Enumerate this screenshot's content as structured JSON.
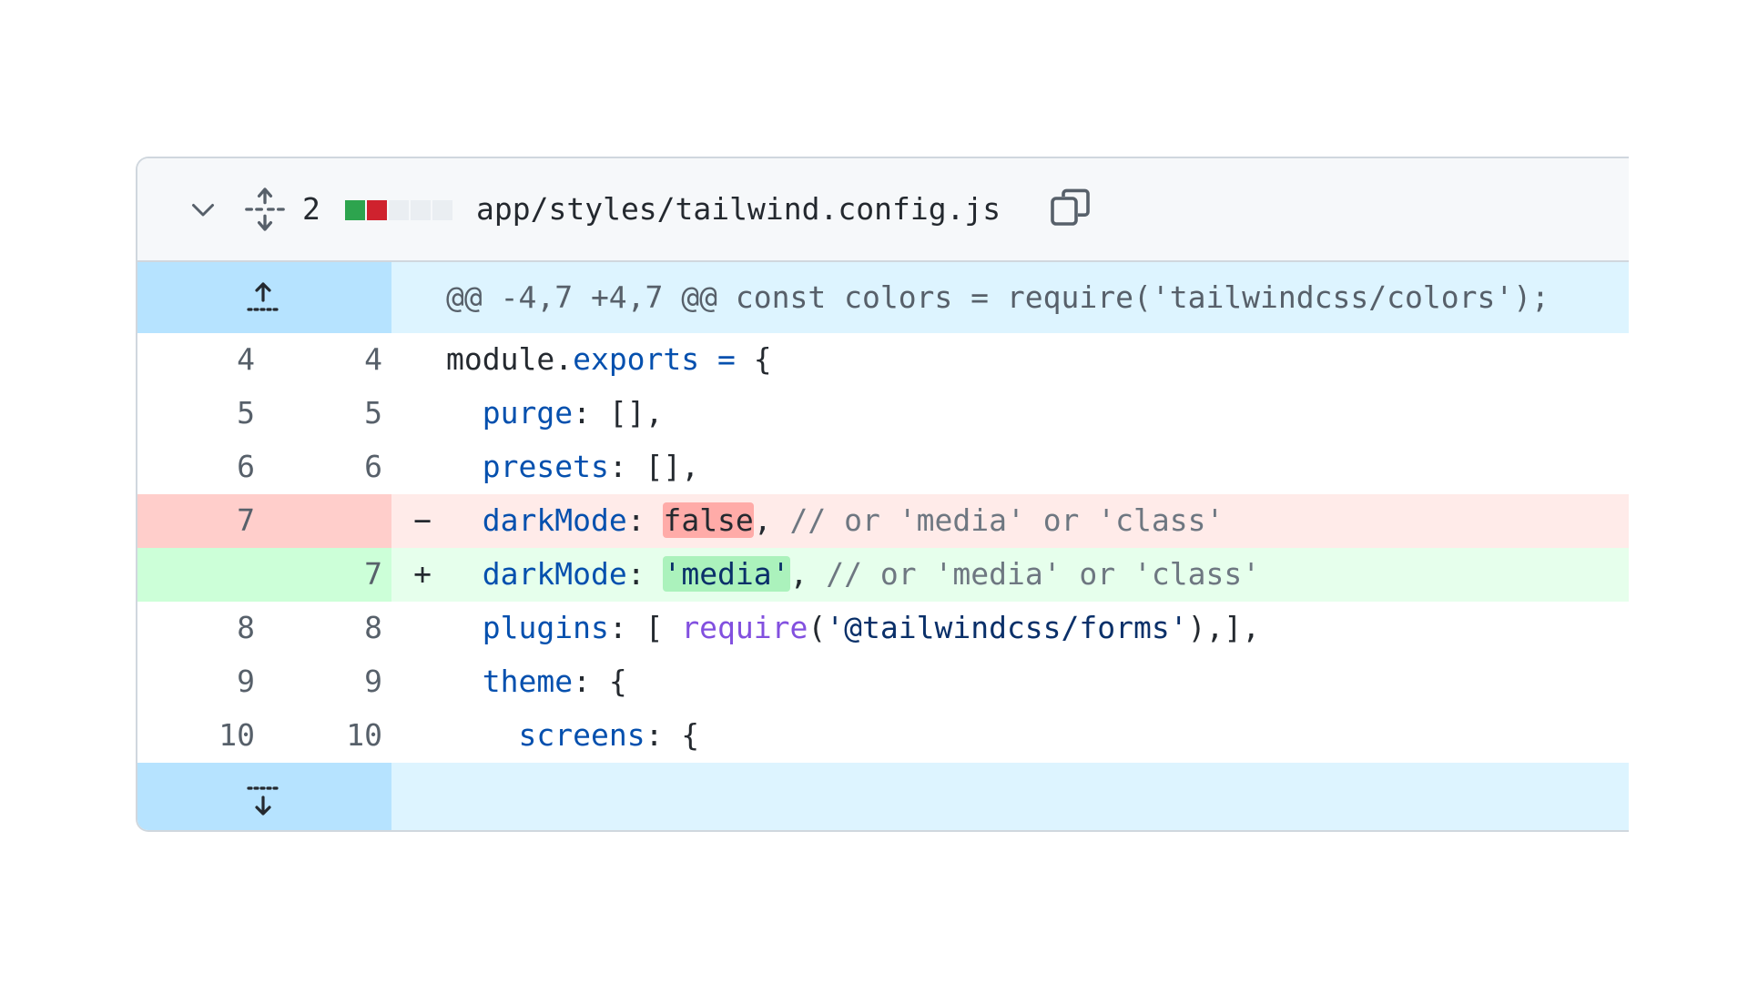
{
  "file": {
    "change_count": "2",
    "path": "app/styles/tailwind.config.js",
    "diffstat": [
      "#2da44e",
      "#cf222e",
      "#eaeef2",
      "#eaeef2",
      "#eaeef2"
    ]
  },
  "hunk": {
    "header": "@@ -4,7 +4,7 @@ const colors = require('tailwindcss/colors');"
  },
  "lines": [
    {
      "old": "4",
      "new": "4",
      "sign": "",
      "type": "ctx",
      "parts": [
        {
          "t": "module.",
          "c": ""
        },
        {
          "t": "exports",
          "c": "k"
        },
        {
          "t": " = ",
          "c": "k"
        },
        {
          "t": "{",
          "c": ""
        }
      ]
    },
    {
      "old": "5",
      "new": "5",
      "sign": "",
      "type": "ctx",
      "parts": [
        {
          "t": "  ",
          "c": ""
        },
        {
          "t": "purge",
          "c": "k"
        },
        {
          "t": ": [],",
          "c": ""
        }
      ]
    },
    {
      "old": "6",
      "new": "6",
      "sign": "",
      "type": "ctx",
      "parts": [
        {
          "t": "  ",
          "c": ""
        },
        {
          "t": "presets",
          "c": "k"
        },
        {
          "t": ": [],",
          "c": ""
        }
      ]
    },
    {
      "old": "7",
      "new": "",
      "sign": "−",
      "type": "del",
      "parts": [
        {
          "t": "  ",
          "c": ""
        },
        {
          "t": "darkMode",
          "c": "k"
        },
        {
          "t": ": ",
          "c": ""
        },
        {
          "t": "false",
          "c": "mark-del"
        },
        {
          "t": ", ",
          "c": ""
        },
        {
          "t": "// or 'media' or 'class'",
          "c": "c"
        }
      ]
    },
    {
      "old": "",
      "new": "7",
      "sign": "+",
      "type": "add",
      "parts": [
        {
          "t": "  ",
          "c": ""
        },
        {
          "t": "darkMode",
          "c": "k"
        },
        {
          "t": ": ",
          "c": ""
        },
        {
          "t": "'media'",
          "c": "s mark-add"
        },
        {
          "t": ", ",
          "c": ""
        },
        {
          "t": "// or 'media' or 'class'",
          "c": "c"
        }
      ]
    },
    {
      "old": "8",
      "new": "8",
      "sign": "",
      "type": "ctx",
      "parts": [
        {
          "t": "  ",
          "c": ""
        },
        {
          "t": "plugins",
          "c": "k"
        },
        {
          "t": ": [ ",
          "c": ""
        },
        {
          "t": "require",
          "c": "f"
        },
        {
          "t": "(",
          "c": ""
        },
        {
          "t": "'@tailwindcss/forms'",
          "c": "s"
        },
        {
          "t": "),],",
          "c": ""
        }
      ]
    },
    {
      "old": "9",
      "new": "9",
      "sign": "",
      "type": "ctx",
      "parts": [
        {
          "t": "  ",
          "c": ""
        },
        {
          "t": "theme",
          "c": "k"
        },
        {
          "t": ": {",
          "c": ""
        }
      ]
    },
    {
      "old": "10",
      "new": "10",
      "sign": "",
      "type": "ctx",
      "parts": [
        {
          "t": "    ",
          "c": ""
        },
        {
          "t": "screens",
          "c": "k"
        },
        {
          "t": ": {",
          "c": ""
        }
      ]
    }
  ]
}
